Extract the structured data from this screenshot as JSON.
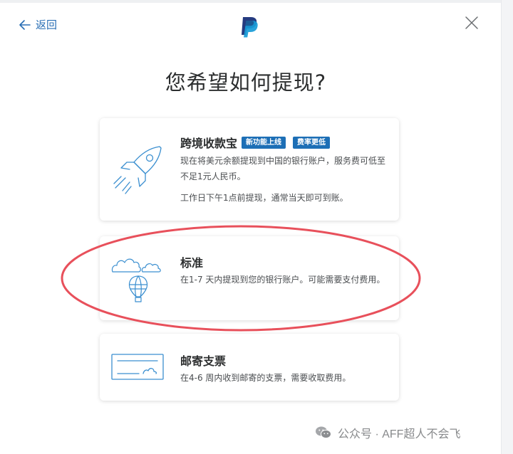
{
  "header": {
    "back_label": "返回"
  },
  "page": {
    "title": "您希望如何提现?"
  },
  "options": [
    {
      "title": "跨境收款宝",
      "badges": [
        "新功能上线",
        "费率更低"
      ],
      "description": "现在将美元余额提现到中国的银行账户，服务费可低至不足1元人民币。",
      "note": "工作日下午1点前提现，通常当天即可到账。",
      "icon": "rocket-icon"
    },
    {
      "title": "标准",
      "description": "在1-7 天内提现到您的银行账户。可能需要支付费用。",
      "icon": "hot-air-balloon-icon"
    },
    {
      "title": "邮寄支票",
      "description": "在4-6 周内收到邮寄的支票，需要收取费用。",
      "icon": "check-icon"
    }
  ],
  "watermark": {
    "text": "公众号 · AFF超人不会飞"
  },
  "colors": {
    "accent": "#1d6fb6",
    "link": "#2a6fb5",
    "highlight": "#e8505b",
    "icon_stroke": "#3b8fd0"
  }
}
